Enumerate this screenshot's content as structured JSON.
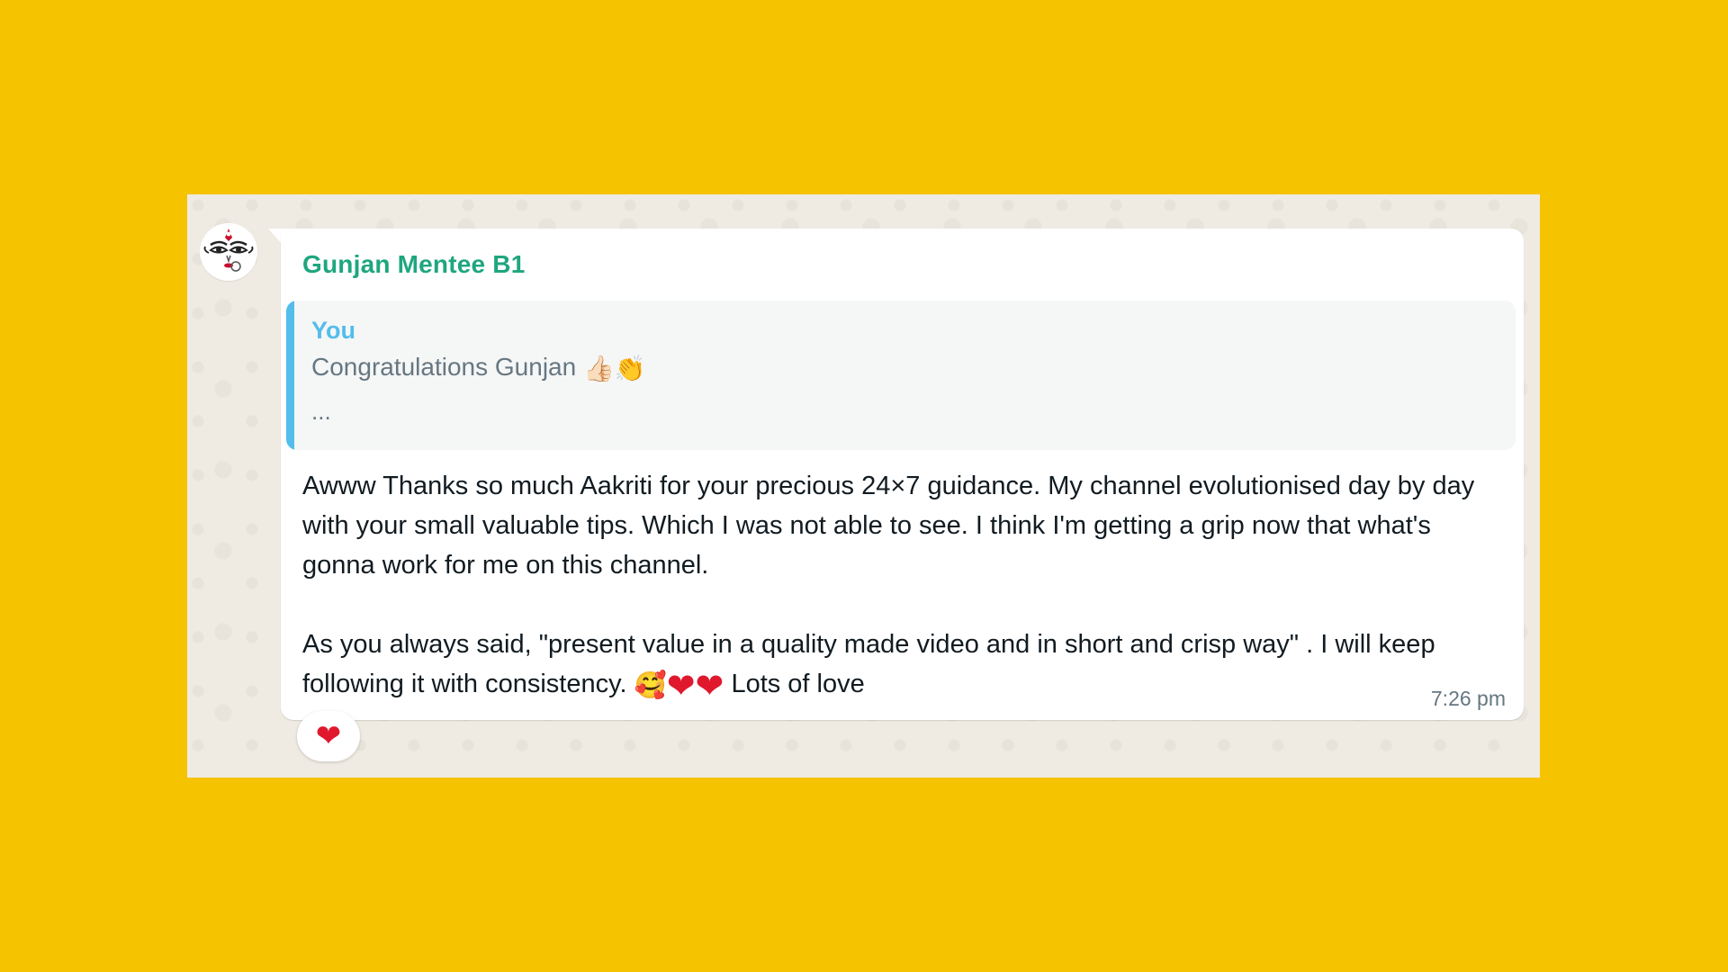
{
  "message": {
    "sender": "Gunjan Mentee B1",
    "quoted": {
      "author": "You",
      "text": "Congratulations Gunjan",
      "emojis": [
        "👍🏻",
        "👏"
      ],
      "ellipsis": "..."
    },
    "paragraph1": "Awww Thanks so much Aakriti for your precious 24×7 guidance. My channel evolutionised day by day with your small valuable tips. Which I was not able to see. I think I'm getting a grip now that what's gonna work for me on this channel.",
    "paragraph2_text": "As you always said, \"present value in a quality made video and in short and crisp way\" . I will keep following it with consistency.",
    "paragraph2_emojis": [
      "🥰",
      "❤",
      "❤"
    ],
    "paragraph2_end": "Lots of love",
    "time": "7:26 pm",
    "reaction": "❤"
  },
  "colors": {
    "background": "#F6C300",
    "sender_name": "#1FA67E",
    "quote_accent": "#53BDEB",
    "heart": "#E0182D"
  },
  "icons": {
    "avatar": "goddess-face-avatar-icon",
    "thumbs_up": "thumbs-up-icon",
    "clap": "clapping-hands-icon",
    "smiling_hearts": "smiling-face-with-hearts-icon",
    "heart": "red-heart-icon"
  }
}
